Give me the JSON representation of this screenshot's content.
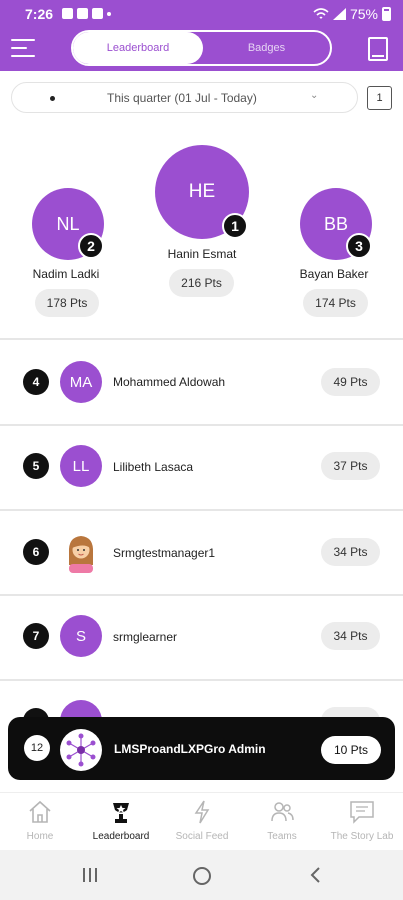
{
  "status_bar": {
    "time": "7:26",
    "battery": "75%"
  },
  "header": {
    "tab_active": "Leaderboard",
    "tab_inactive": "Badges"
  },
  "filter": {
    "period": "This quarter (01 Jul - Today)",
    "page": "1"
  },
  "podium": [
    {
      "rank": "1",
      "initials": "HE",
      "name": "Hanin Esmat",
      "points": "216 Pts"
    },
    {
      "rank": "2",
      "initials": "NL",
      "name": "Nadim  Ladki",
      "points": "178 Pts"
    },
    {
      "rank": "3",
      "initials": "BB",
      "name": "Bayan Baker",
      "points": "174 Pts"
    }
  ],
  "list": [
    {
      "rank": "4",
      "initials": "MA",
      "name": "Mohammed Aldowah",
      "points": "49 Pts"
    },
    {
      "rank": "5",
      "initials": "LL",
      "name": "Lilibeth Lasaca",
      "points": "37 Pts"
    },
    {
      "rank": "6",
      "initials": "",
      "name": "Srmgtestmanager1",
      "points": "34 Pts"
    },
    {
      "rank": "7",
      "initials": "S",
      "name": "srmglearner",
      "points": "34 Pts"
    }
  ],
  "current_user": {
    "rank": "12",
    "name": "LMSProandLXPGro Admin",
    "points": "10 Pts"
  },
  "bottom_nav": [
    {
      "label": "Home",
      "icon": "home-icon"
    },
    {
      "label": "Leaderboard",
      "icon": "trophy-icon"
    },
    {
      "label": "Social Feed",
      "icon": "lightning-icon"
    },
    {
      "label": "Teams",
      "icon": "people-icon"
    },
    {
      "label": "The Story Lab",
      "icon": "chat-icon"
    }
  ],
  "colors": {
    "brand": "#9b4fd0",
    "dark": "#111111",
    "pill": "#ececec"
  }
}
